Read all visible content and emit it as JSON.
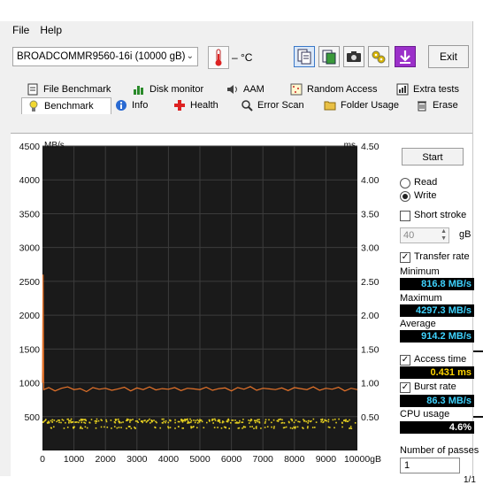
{
  "menu": {
    "file": "File",
    "help": "Help"
  },
  "toolbar": {
    "drive": "BROADCOMMR9560-16i (10000 gB)",
    "temperature": "– °C",
    "exit_label": "Exit"
  },
  "tabs_row1": [
    "File Benchmark",
    "Disk monitor",
    "AAM",
    "Random Access",
    "Extra tests"
  ],
  "tabs_row2": [
    "Benchmark",
    "Info",
    "Health",
    "Error Scan",
    "Folder Usage",
    "Erase"
  ],
  "active_tab": "Benchmark",
  "side": {
    "start_label": "Start",
    "read_label": "Read",
    "write_label": "Write",
    "mode_selected": "Write",
    "short_stroke_label": "Short stroke",
    "short_stroke_checked": false,
    "stroke_value": "40",
    "stroke_unit": "gB",
    "transfer_rate_label": "Transfer rate",
    "transfer_rate_checked": true,
    "minimum_label": "Minimum",
    "minimum_value": "816.8 MB/s",
    "maximum_label": "Maximum",
    "maximum_value": "4297.3 MB/s",
    "average_label": "Average",
    "average_value": "914.2 MB/s",
    "access_time_label": "Access time",
    "access_time_checked": true,
    "access_time_value": "0.431 ms",
    "burst_rate_label": "Burst rate",
    "burst_rate_checked": true,
    "burst_rate_value": "86.3 MB/s",
    "cpu_usage_label": "CPU usage",
    "cpu_usage_value": "4.6%",
    "passes_label": "Number of passes",
    "passes_value": "1",
    "passes_progress": "1/1"
  },
  "chart_data": {
    "type": "line",
    "x_unit": "gB",
    "y_left_unit": "MB/s",
    "y_right_unit": "ms",
    "x_ticks": [
      "0",
      "1000",
      "2000",
      "3000",
      "4000",
      "5000",
      "6000",
      "7000",
      "8000",
      "9000",
      "10000gB"
    ],
    "y_left_ticks": [
      "4500",
      "4000",
      "3500",
      "3000",
      "2500",
      "2000",
      "1500",
      "1000",
      "500"
    ],
    "y_right_ticks": [
      "4.50",
      "4.00",
      "3.50",
      "3.00",
      "2.50",
      "2.00",
      "1.50",
      "1.00",
      "0.50"
    ],
    "xlim": [
      0,
      10000
    ],
    "ylim_left": [
      0,
      4500
    ],
    "ylim_right": [
      0,
      4.5
    ],
    "grid": true,
    "series": [
      {
        "name": "Transfer rate",
        "axis": "left",
        "color": "#e8742a",
        "x": [
          0,
          20,
          40,
          200,
          400,
          600,
          800,
          1000,
          1200,
          1400,
          1600,
          1800,
          2000,
          2200,
          2400,
          2600,
          2800,
          3000,
          3200,
          3400,
          3600,
          3800,
          4000,
          4200,
          4400,
          4600,
          4800,
          5000,
          5200,
          5400,
          5600,
          5800,
          6000,
          6200,
          6400,
          6600,
          6800,
          7000,
          7200,
          7400,
          7600,
          7800,
          8000,
          8200,
          8400,
          8600,
          8800,
          9000,
          9200,
          9400,
          9600,
          9800,
          10000
        ],
        "y": [
          1000,
          2600,
          900,
          930,
          880,
          920,
          940,
          900,
          915,
          870,
          930,
          905,
          920,
          890,
          910,
          935,
          880,
          925,
          900,
          940,
          895,
          915,
          905,
          930,
          885,
          920,
          910,
          900,
          935,
          890,
          915,
          925,
          880,
          930,
          905,
          945,
          890,
          920,
          910,
          900,
          925,
          885,
          930,
          915,
          900,
          940,
          890,
          920,
          905,
          935,
          880,
          920,
          900
        ]
      },
      {
        "name": "Access time",
        "axis": "right",
        "color": "#e6d020",
        "bands": [
          0.46,
          0.43,
          0.35
        ]
      }
    ]
  },
  "colors": {
    "accent": "#3fd3ff",
    "chart_bg": "#1a1a1a",
    "transfer": "#e8742a",
    "access": "#e6d020"
  }
}
